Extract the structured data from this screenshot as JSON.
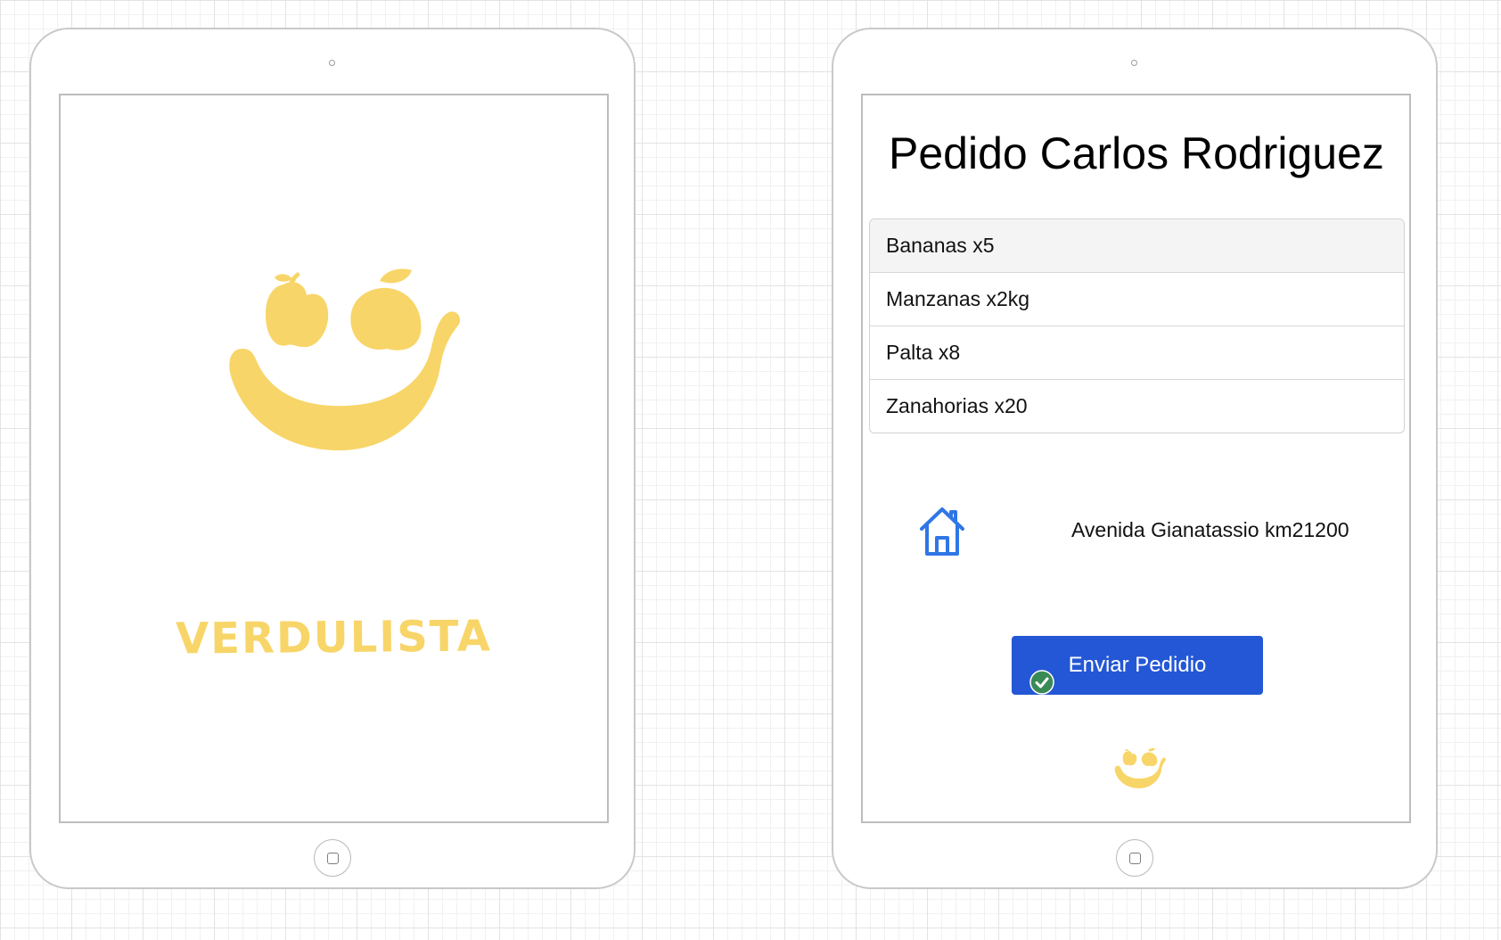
{
  "splash": {
    "brand_name": "VERDULISTA",
    "logo_icon": "fruit-smiley-icon",
    "brand_color": "#f8d568"
  },
  "order": {
    "title": "Pedido Carlos Rodriguez",
    "items": [
      {
        "label": "Bananas x5"
      },
      {
        "label": "Manzanas x2kg"
      },
      {
        "label": "Palta x8"
      },
      {
        "label": "Zanahorias x20"
      }
    ],
    "address": {
      "icon": "house-icon",
      "text": "Avenida Gianatassio km21200"
    },
    "send_button": {
      "label": "Enviar Pedidio",
      "color": "#2457d6",
      "badge_icon": "check-circle-icon",
      "badge_color": "#3a8a55"
    },
    "footer_logo_icon": "fruit-smiley-icon"
  },
  "colors": {
    "accent_yellow": "#f8d568",
    "primary_blue": "#2457d6",
    "icon_blue": "#2f76e6"
  }
}
